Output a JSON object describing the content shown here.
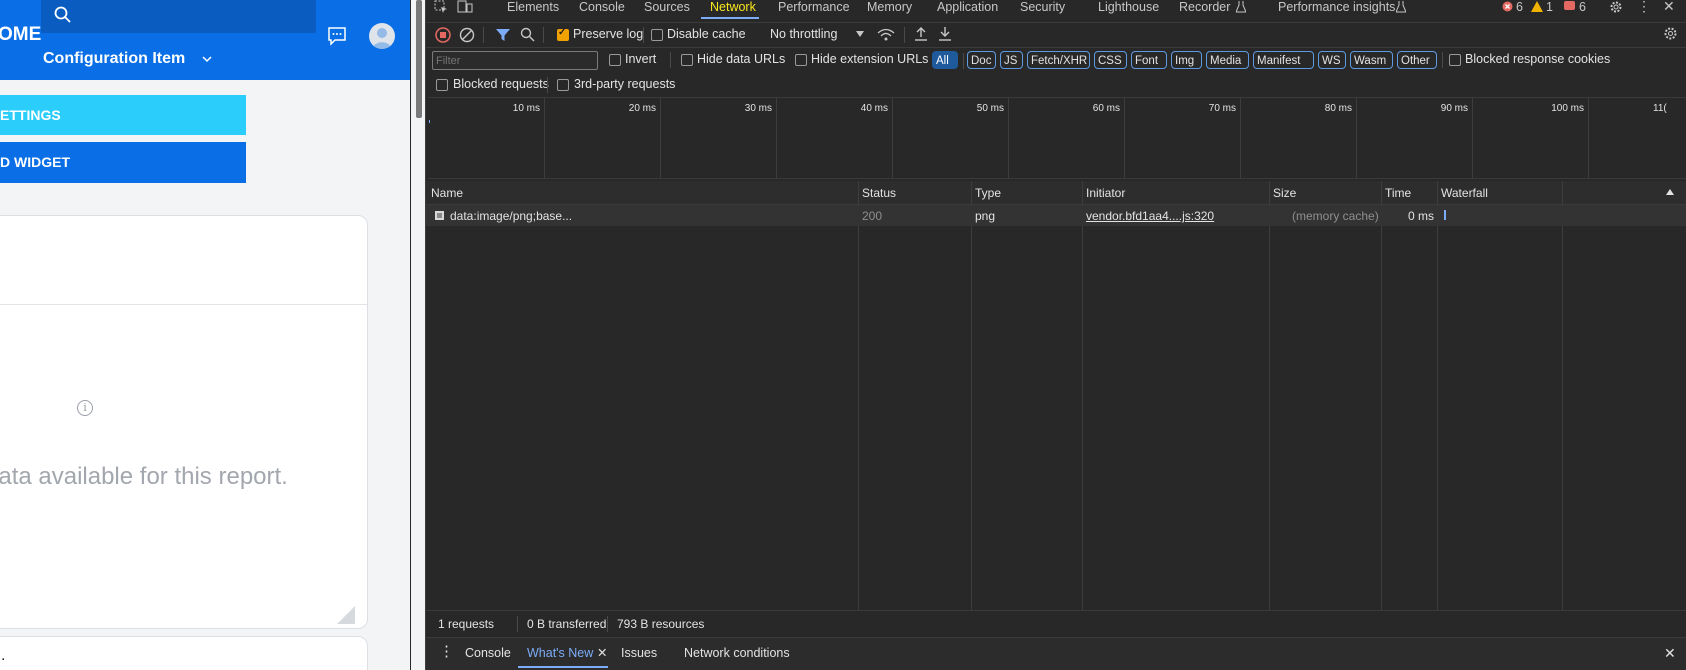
{
  "app": {
    "home_text": "OME",
    "ci_select_label": "Configuration Item",
    "settings_button": "ETTINGS",
    "widget_button": "D WIDGET",
    "info_glyph": "i",
    "empty_message": "data available for this report.",
    "card2_text": ".",
    "colors": {
      "header": "#0a6fe6",
      "settings_button": "#2bcdfb",
      "widget_button": "#0a6fe6"
    }
  },
  "devtools": {
    "panel_tabs": [
      "Elements",
      "Console",
      "Sources",
      "Network",
      "Performance",
      "Memory",
      "Application",
      "Security",
      "Lighthouse",
      "Recorder",
      "Performance insights"
    ],
    "active_tab": "Network",
    "error_count": "6",
    "warning_count": "1",
    "issue_count": "6",
    "toolbar": {
      "preserve_log": "Preserve log",
      "disable_cache": "Disable cache",
      "throttling": "No throttling"
    },
    "filter": {
      "placeholder": "Filter",
      "invert": "Invert",
      "hide_data_urls": "Hide data URLs",
      "hide_extension_urls": "Hide extension URLs",
      "types": [
        "All",
        "Doc",
        "JS",
        "Fetch/XHR",
        "CSS",
        "Font",
        "Img",
        "Media",
        "Manifest",
        "WS",
        "Wasm",
        "Other"
      ],
      "blocked_response_cookies": "Blocked response cookies",
      "blocked_requests": "Blocked requests",
      "third_party_requests": "3rd-party requests"
    },
    "timeline_ticks": [
      "10 ms",
      "20 ms",
      "30 ms",
      "40 ms",
      "50 ms",
      "60 ms",
      "70 ms",
      "80 ms",
      "90 ms",
      "100 ms",
      "11("
    ],
    "columns": [
      "Name",
      "Status",
      "Type",
      "Initiator",
      "Size",
      "Time",
      "Waterfall"
    ],
    "rows": [
      {
        "name": "data:image/png;base...",
        "status": "200",
        "type": "png",
        "initiator": "vendor.bfd1aa4....js:320",
        "size": "(memory cache)",
        "time": "0 ms"
      }
    ],
    "status_bar": {
      "requests": "1 requests",
      "transferred": "0 B transferred",
      "resources": "793 B resources"
    },
    "drawer_tabs": [
      "Console",
      "What's New",
      "Issues",
      "Network conditions"
    ],
    "active_drawer_tab": "What's New"
  }
}
